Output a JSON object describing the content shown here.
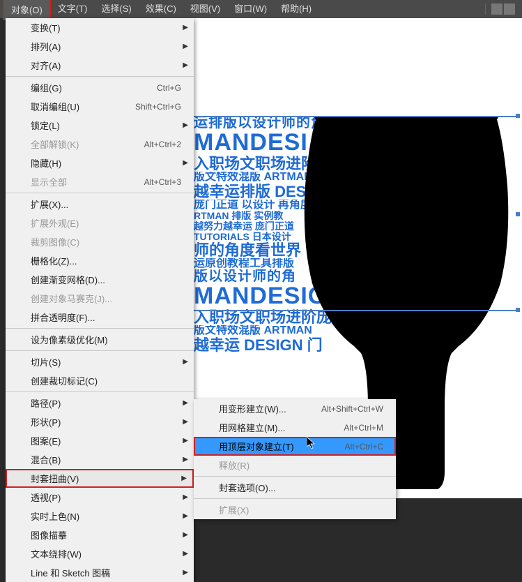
{
  "menubar": {
    "items": [
      {
        "label": "对象(O)",
        "active": true
      },
      {
        "label": "文字(T)"
      },
      {
        "label": "选择(S)"
      },
      {
        "label": "效果(C)"
      },
      {
        "label": "视图(V)"
      },
      {
        "label": "窗口(W)"
      },
      {
        "label": "帮助(H)"
      }
    ]
  },
  "menu1": [
    {
      "label": "变换(T)",
      "arrow": true
    },
    {
      "label": "排列(A)",
      "arrow": true
    },
    {
      "label": "对齐(A)",
      "arrow": true
    },
    {
      "sep": true
    },
    {
      "label": "编组(G)",
      "shortcut": "Ctrl+G"
    },
    {
      "label": "取消编组(U)",
      "shortcut": "Shift+Ctrl+G"
    },
    {
      "label": "锁定(L)",
      "arrow": true
    },
    {
      "label": "全部解锁(K)",
      "shortcut": "Alt+Ctrl+2",
      "disabled": true
    },
    {
      "label": "隐藏(H)",
      "arrow": true
    },
    {
      "label": "显示全部",
      "shortcut": "Alt+Ctrl+3",
      "disabled": true
    },
    {
      "sep": true
    },
    {
      "label": "扩展(X)..."
    },
    {
      "label": "扩展外观(E)",
      "disabled": true
    },
    {
      "label": "裁剪图像(C)",
      "disabled": true
    },
    {
      "label": "栅格化(Z)..."
    },
    {
      "label": "创建渐变网格(D)..."
    },
    {
      "label": "创建对象马赛克(J)...",
      "disabled": true
    },
    {
      "label": "拼合透明度(F)..."
    },
    {
      "sep": true
    },
    {
      "label": "设为像素级优化(M)"
    },
    {
      "sep": true
    },
    {
      "label": "切片(S)",
      "arrow": true
    },
    {
      "label": "创建裁切标记(C)"
    },
    {
      "sep": true
    },
    {
      "label": "路径(P)",
      "arrow": true
    },
    {
      "label": "形状(P)",
      "arrow": true
    },
    {
      "label": "图案(E)",
      "arrow": true
    },
    {
      "label": "混合(B)",
      "arrow": true
    },
    {
      "label": "封套扭曲(V)",
      "arrow": true,
      "highlighted": true
    },
    {
      "label": "透视(P)",
      "arrow": true
    },
    {
      "label": "实时上色(N)",
      "arrow": true
    },
    {
      "label": "图像描摹",
      "arrow": true
    },
    {
      "label": "文本绕排(W)",
      "arrow": true
    },
    {
      "label": "Line 和 Sketch 图稿",
      "arrow": true
    }
  ],
  "menu2": [
    {
      "label": "用变形建立(W)...",
      "shortcut": "Alt+Shift+Ctrl+W"
    },
    {
      "label": "用网格建立(M)...",
      "shortcut": "Alt+Ctrl+M"
    },
    {
      "label": "用顶层对象建立(T)",
      "shortcut": "Alt+Ctrl+C",
      "highlighted": true
    },
    {
      "label": "释放(R)",
      "disabled": true
    },
    {
      "sep": true
    },
    {
      "label": "封套选项(O)..."
    },
    {
      "sep": true
    },
    {
      "label": "扩展(X)",
      "disabled": true
    }
  ],
  "art": {
    "l1": "运排版以设计师的角",
    "big": "MANDESI",
    "l2": "入职场文职场进阶庞",
    "l3": "版文特效混版 ARTMAN",
    "l4": "越幸运排版 DESIGN",
    "l5": "庞门正道 以设计 再角度",
    "l6": "RTMAN 排版 实例教",
    "l7": "越努力越幸运 庞门正道",
    "l8": "TUTORIALS 日本设计",
    "l9": "师的角度看世界",
    "l10": "运原创教程工具排版",
    "l11": "版以设计师的角",
    "big2": "MANDESIGN",
    "l12": "入职场文职场进阶庞",
    "l13": "版文特效混版 ARTMAN",
    "l14": "越幸运 DESIGN 门"
  }
}
